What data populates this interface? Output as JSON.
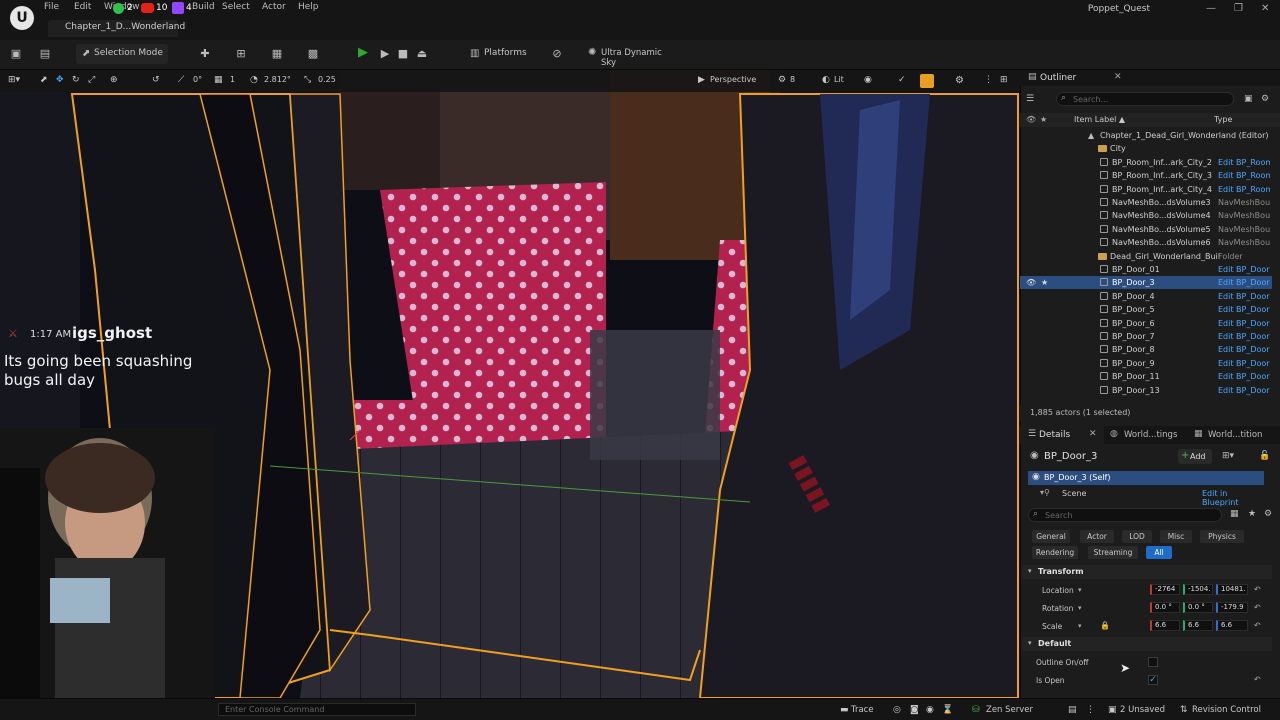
{
  "titlebar": {
    "menu": [
      "File",
      "Edit",
      "Window",
      "Build",
      "Select",
      "Actor",
      "Help"
    ],
    "badge_counts": [
      "2",
      "10",
      "4"
    ],
    "level_tab": "Chapter_1_D...Wonderland",
    "project": "Poppet_Quest",
    "logo_text": "U"
  },
  "toolbar": {
    "selection_mode": "Selection Mode",
    "platforms": "Platforms",
    "sky": "Ultra Dynamic Sky"
  },
  "viewport_toolbar": {
    "rotation_snap": "0°",
    "grid": "1",
    "zoom_value": "2.812°",
    "scale_snap": "0.25",
    "perspective": "Perspective",
    "speed": "8",
    "lit": "Lit"
  },
  "chat": {
    "time": "1:17 AM",
    "user": "igs_ghost",
    "message": "Its going been squashing bugs all day"
  },
  "outliner": {
    "tab": "Outliner",
    "search_placeholder": "Search...",
    "col_label": "Item Label ▲",
    "col_type": "Type",
    "rows": [
      {
        "label": "Chapter_1_Dead_Girl_Wonderland (Editor)",
        "type": "",
        "kind": "world"
      },
      {
        "label": "City",
        "type": "",
        "kind": "folder"
      },
      {
        "label": "BP_Room_Inf...ark_City_2",
        "type": "Edit BP_Room",
        "kind": "bp"
      },
      {
        "label": "BP_Room_Inf...ark_City_3",
        "type": "Edit BP_Room",
        "kind": "bp"
      },
      {
        "label": "BP_Room_Inf...ark_City_4",
        "type": "Edit BP_Room",
        "kind": "bp"
      },
      {
        "label": "NavMeshBo...dsVolume3",
        "type": "NavMeshBou",
        "kind": "gray"
      },
      {
        "label": "NavMeshBo...dsVolume4",
        "type": "NavMeshBou",
        "kind": "gray"
      },
      {
        "label": "NavMeshBo...dsVolume5",
        "type": "NavMeshBou",
        "kind": "gray"
      },
      {
        "label": "NavMeshBo...dsVolume6",
        "type": "NavMeshBou",
        "kind": "gray"
      },
      {
        "label": "Dead_Girl_Wonderland_Buil",
        "type": "Folder",
        "kind": "folder"
      },
      {
        "label": "BP_Door_01",
        "type": "Edit BP_Door",
        "kind": "bp"
      },
      {
        "label": "BP_Door_3",
        "type": "Edit BP_Door",
        "kind": "selected"
      },
      {
        "label": "BP_Door_4",
        "type": "Edit BP_Door",
        "kind": "bp"
      },
      {
        "label": "BP_Door_5",
        "type": "Edit BP_Door",
        "kind": "bp"
      },
      {
        "label": "BP_Door_6",
        "type": "Edit BP_Door",
        "kind": "bp"
      },
      {
        "label": "BP_Door_7",
        "type": "Edit BP_Door",
        "kind": "bp"
      },
      {
        "label": "BP_Door_8",
        "type": "Edit BP_Door",
        "kind": "bp"
      },
      {
        "label": "BP_Door_9",
        "type": "Edit BP_Door",
        "kind": "bp"
      },
      {
        "label": "BP_Door_11",
        "type": "Edit BP_Door",
        "kind": "bp"
      },
      {
        "label": "BP_Door_13",
        "type": "Edit BP_Door",
        "kind": "bp"
      }
    ],
    "actor_count": "1,885 actors (1 selected)"
  },
  "details": {
    "tabs": [
      "Details",
      "World...tings",
      "World...tition"
    ],
    "object_name": "BP_Door_3",
    "add_label": "Add",
    "component_self": "BP_Door_3 (Self)",
    "component_scene": "Scene",
    "edit_blueprint": "Edit in Blueprint",
    "search_placeholder": "Search",
    "categories_row1": [
      "General",
      "Actor",
      "LOD",
      "Misc",
      "Physics"
    ],
    "categories_row2": [
      "Rendering",
      "Streaming",
      "All"
    ],
    "transform_header": "Transform",
    "location_label": "Location",
    "location": [
      "-2764",
      "-1504.",
      "10481."
    ],
    "rotation_label": "Rotation",
    "rotation": [
      "0.0 °",
      "0.0 °",
      "-179.9"
    ],
    "scale_label": "Scale",
    "scale": [
      "6.6",
      "6.6",
      "6.6"
    ],
    "default_header": "Default",
    "outline_label": "Outline On/off",
    "isopen_label": "Is Open"
  },
  "statusbar": {
    "console_placeholder": "Enter Console Command",
    "trace": "Trace",
    "zen": "Zen Server",
    "unsaved": "2 Unsaved",
    "revision": "Revision Control"
  },
  "colors": {
    "selection_outline": "#f0a020",
    "accent_blue": "#1e6cc8",
    "link_blue": "#4aa8ff",
    "polka_pink": "#c0285a"
  }
}
